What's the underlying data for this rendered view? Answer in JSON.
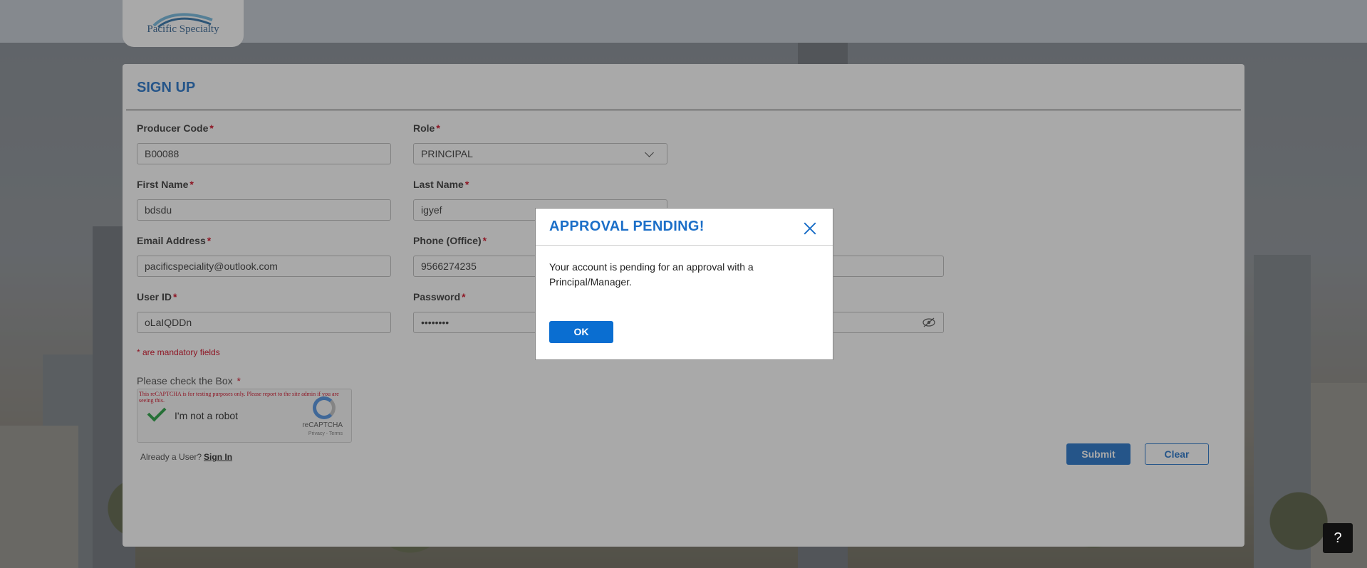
{
  "brand": {
    "logo_text": "Pacific Specialty"
  },
  "signup": {
    "title": "SIGN UP",
    "fields": {
      "producer_code": {
        "label": "Producer Code",
        "value": "B00088"
      },
      "role": {
        "label": "Role",
        "value": "PRINCIPAL"
      },
      "first_name": {
        "label": "First Name",
        "value": "bdsdu"
      },
      "last_name": {
        "label": "Last Name",
        "value": "igyef"
      },
      "email": {
        "label": "Email Address",
        "value": "pacificspeciality@outlook.com"
      },
      "phone": {
        "label": "Phone (Office)",
        "value": "9566274235"
      },
      "user_id": {
        "label": "User ID",
        "value": "oLaIQDDn"
      },
      "password": {
        "label": "Password",
        "value": "••••••••"
      }
    },
    "required_marker": "*",
    "mandatory_note": "* are mandatory fields",
    "captcha": {
      "label": "Please check the Box",
      "warning": "This reCAPTCHA is for testing purposes only. Please report to the site admin if you are seeing this.",
      "checkbox_text": "I'm not a robot",
      "brand": "reCAPTCHA",
      "links": "Privacy - Terms"
    },
    "already_user": "Already a User?",
    "sign_in": "Sign In",
    "submit": "Submit",
    "clear": "Clear"
  },
  "modal": {
    "title": "APPROVAL PENDING!",
    "message": "Your account is pending for an approval with a Principal/Manager.",
    "ok": "OK"
  },
  "help": {
    "label": "?"
  },
  "colors": {
    "accent": "#1c6fc8",
    "required": "#d0021b"
  }
}
